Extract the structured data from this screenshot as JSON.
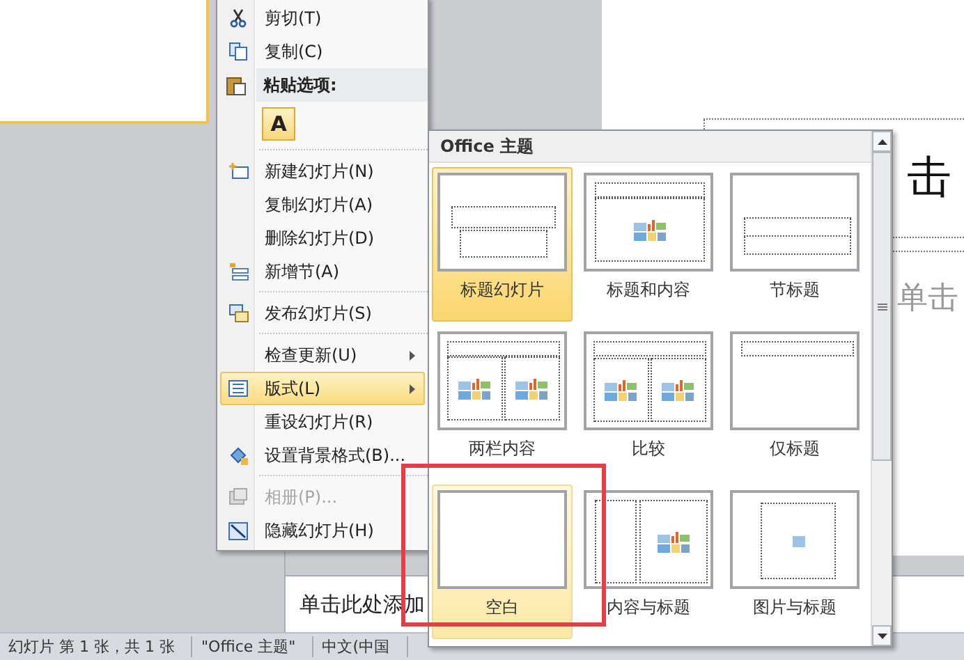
{
  "slide_pane": {
    "thumbnail": {
      "selected": true
    }
  },
  "slide": {
    "title_placeholder": "击",
    "subtitle_placeholder": "单击"
  },
  "notes": {
    "placeholder": "单击此处添加"
  },
  "context_menu": {
    "items": [
      {
        "kind": "item",
        "label": "剪切(T)",
        "selected": false,
        "disabled": false,
        "submenu": false
      },
      {
        "kind": "item",
        "label": "复制(C)",
        "selected": false,
        "disabled": false,
        "submenu": false
      },
      {
        "kind": "header",
        "label": "粘贴选项:"
      },
      {
        "kind": "paste",
        "label": "A"
      },
      {
        "kind": "separator"
      },
      {
        "kind": "item",
        "label": "新建幻灯片(N)",
        "selected": false,
        "disabled": false,
        "submenu": false
      },
      {
        "kind": "item",
        "label": "复制幻灯片(A)",
        "selected": false,
        "disabled": false,
        "submenu": false
      },
      {
        "kind": "item",
        "label": "删除幻灯片(D)",
        "selected": false,
        "disabled": false,
        "submenu": false
      },
      {
        "kind": "item",
        "label": "新增节(A)",
        "selected": false,
        "disabled": false,
        "submenu": false
      },
      {
        "kind": "separator"
      },
      {
        "kind": "item",
        "label": "发布幻灯片(S)",
        "selected": false,
        "disabled": false,
        "submenu": false
      },
      {
        "kind": "separator"
      },
      {
        "kind": "item",
        "label": "检查更新(U)",
        "selected": false,
        "disabled": false,
        "submenu": true
      },
      {
        "kind": "item",
        "label": "版式(L)",
        "selected": true,
        "disabled": false,
        "submenu": true
      },
      {
        "kind": "item",
        "label": "重设幻灯片(R)",
        "selected": false,
        "disabled": false,
        "submenu": false
      },
      {
        "kind": "item",
        "label": "设置背景格式(B)...",
        "selected": false,
        "disabled": false,
        "submenu": false
      },
      {
        "kind": "separator"
      },
      {
        "kind": "item",
        "label": "相册(P)...",
        "selected": false,
        "disabled": true,
        "submenu": false
      },
      {
        "kind": "item",
        "label": "隐藏幻灯片(H)",
        "selected": false,
        "disabled": false,
        "submenu": false
      }
    ]
  },
  "layout_gallery": {
    "title": "Office 主题",
    "layouts": [
      {
        "kind": "title",
        "label": "标题幻灯片",
        "selected": true,
        "hovered": false
      },
      {
        "kind": "title-content",
        "label": "标题和内容",
        "selected": false,
        "hovered": false
      },
      {
        "kind": "section",
        "label": "节标题",
        "selected": false,
        "hovered": false
      },
      {
        "kind": "two-content",
        "label": "两栏内容",
        "selected": false,
        "hovered": false
      },
      {
        "kind": "comparison",
        "label": "比较",
        "selected": false,
        "hovered": false
      },
      {
        "kind": "title-only",
        "label": "仅标题",
        "selected": false,
        "hovered": false
      },
      {
        "kind": "blank",
        "label": "空白",
        "selected": false,
        "hovered": true
      },
      {
        "kind": "content-caption",
        "label": "内容与标题",
        "selected": false,
        "hovered": false
      },
      {
        "kind": "picture-caption",
        "label": "图片与标题",
        "selected": false,
        "hovered": false
      }
    ]
  },
  "status_bar": [
    "幻灯片 第 1 张，共 1 张",
    "\"Office 主题\"",
    "中文(中国"
  ]
}
